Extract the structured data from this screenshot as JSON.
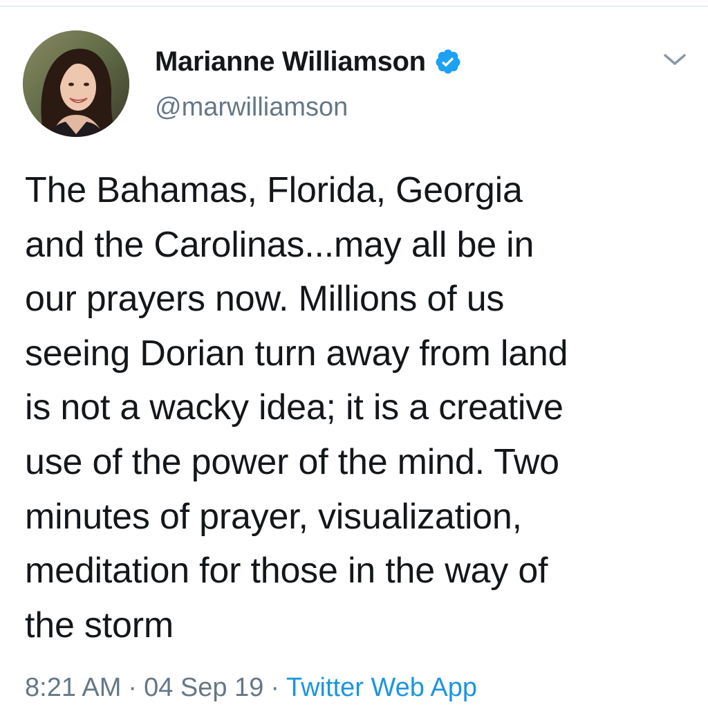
{
  "user": {
    "display_name": "Marianne Williamson",
    "handle": "@marwilliamson",
    "verified": true
  },
  "tweet": {
    "text_lines": [
      "The Bahamas, Florida, Georgia",
      "and the Carolinas...may all be in",
      "our prayers now. Millions of us",
      "seeing Dorian turn away from land",
      "is not a wacky idea; it is a creative",
      "use of the power of the mind. Two",
      "minutes of prayer, visualization,",
      "meditation for those in the way of",
      "the storm"
    ],
    "time": "8:21 AM",
    "date": "04 Sep 19",
    "source": "Twitter Web App",
    "separator": "·"
  },
  "icons": {
    "verified": "verified-badge-icon",
    "more": "chevron-down-icon"
  },
  "colors": {
    "text": "#14171a",
    "secondary": "#657786",
    "link": "#1b95e0",
    "verified": "#1da1f2"
  }
}
